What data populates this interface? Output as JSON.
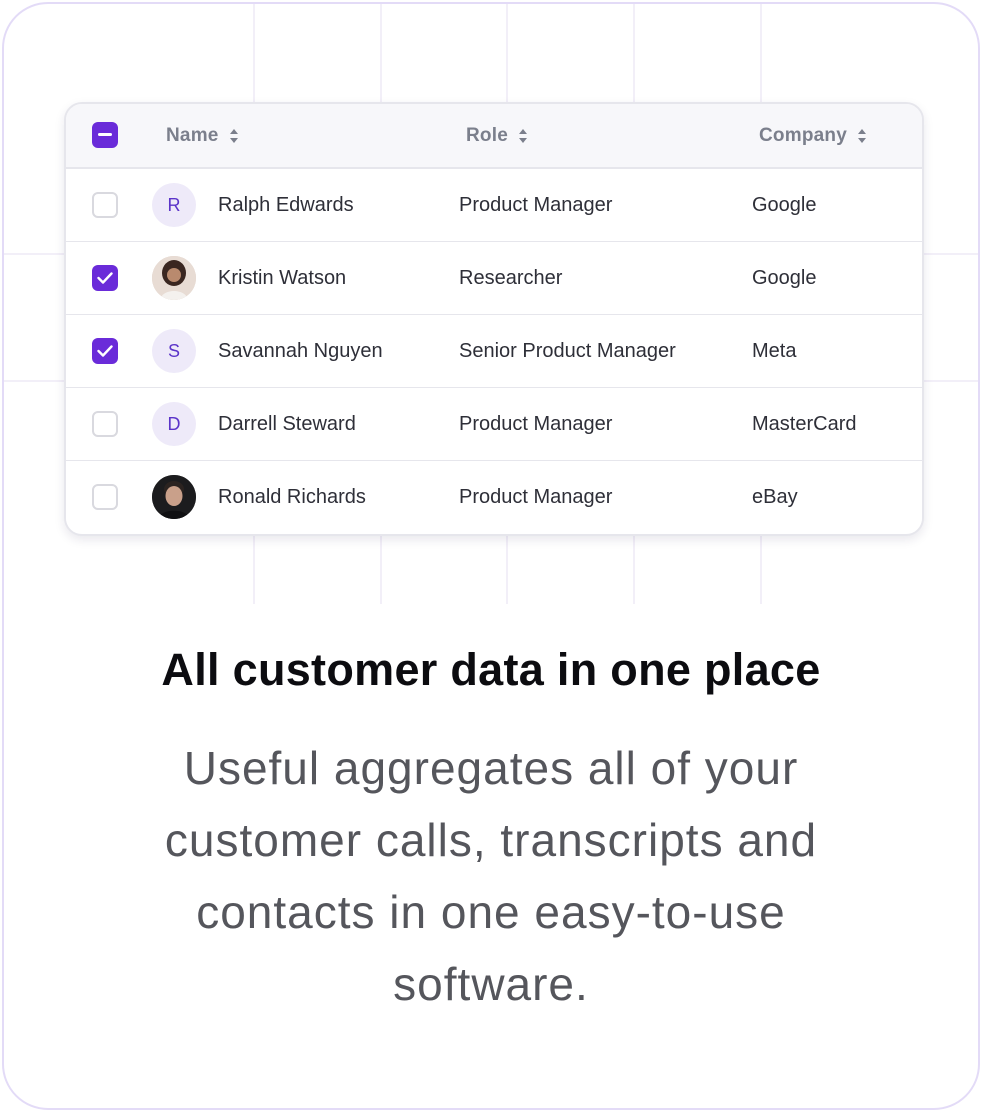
{
  "table": {
    "headers": {
      "name": "Name",
      "role": "Role",
      "company": "Company"
    },
    "select_all_state": "indeterminate",
    "rows": [
      {
        "name": "Ralph Edwards",
        "role": "Product Manager",
        "company": "Google",
        "checked": false,
        "avatar_initial": "R",
        "avatar_type": "initial"
      },
      {
        "name": "Kristin Watson",
        "role": "Researcher",
        "company": "Google",
        "checked": true,
        "avatar_initial": "",
        "avatar_type": "photo"
      },
      {
        "name": "Savannah Nguyen",
        "role": "Senior Product Manager",
        "company": "Meta",
        "checked": true,
        "avatar_initial": "S",
        "avatar_type": "initial"
      },
      {
        "name": "Darrell Steward",
        "role": "Product Manager",
        "company": "MasterCard",
        "checked": false,
        "avatar_initial": "D",
        "avatar_type": "initial"
      },
      {
        "name": "Ronald Richards",
        "role": "Product Manager",
        "company": "eBay",
        "checked": false,
        "avatar_initial": "",
        "avatar_type": "photo"
      }
    ]
  },
  "headline": "All customer data in one place",
  "description": "Useful aggregates all of your customer calls, transcripts and contacts in one easy-to-use software.",
  "colors": {
    "accent": "#6a2bd9",
    "card_border": "#e3dbf7",
    "avatar_bg": "#eeeaf9",
    "avatar_text": "#5b34c9",
    "headline": "#0c0c10",
    "description": "#55565c"
  },
  "icons": {
    "sort": "sort-updown-icon",
    "check": "check-icon",
    "minus": "minus-icon"
  }
}
